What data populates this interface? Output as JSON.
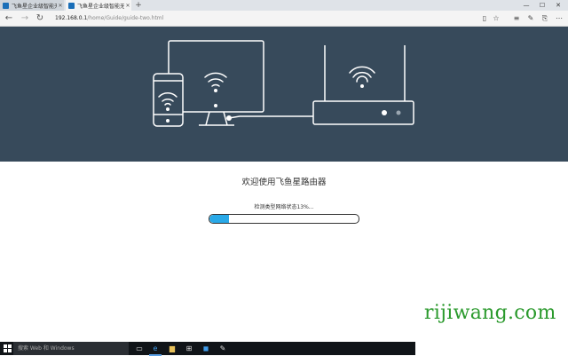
{
  "browser": {
    "tabs": [
      {
        "label": "飞鱼星企业级智能无线 | 科",
        "active": false
      },
      {
        "label": "飞鱼星企业级智能无线",
        "active": true
      }
    ],
    "new_tab_symbol": "+",
    "address": {
      "host": "192.168.0.1",
      "path": "/home/Guide/guide-two.html"
    }
  },
  "page": {
    "title": "欢迎使用飞鱼星路由器",
    "status_text": "检测类型网络状态13%...",
    "progress": 0.13
  },
  "colors": {
    "hero_bg": "#374a5b",
    "progress_fill": "#29a9e8",
    "watermark": "#2b9a2d"
  },
  "watermark": "rijiwang.com",
  "taskbar": {
    "search_placeholder": "搜索 Web 和 Windows"
  }
}
